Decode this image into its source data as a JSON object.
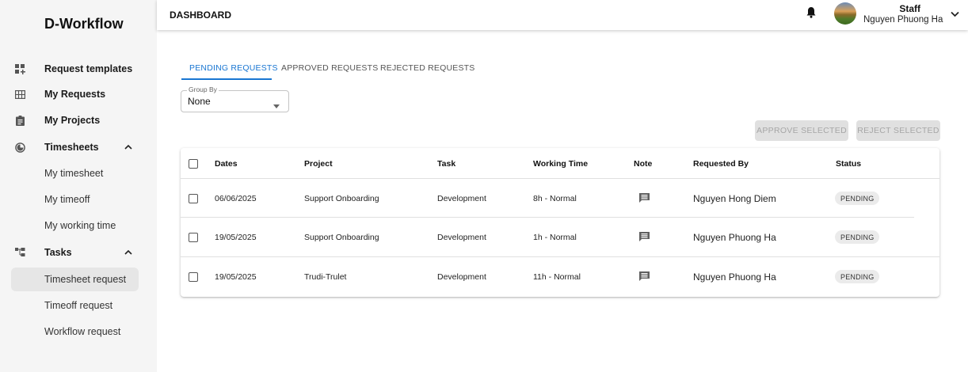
{
  "app": {
    "brand": "D-Workflow"
  },
  "header": {
    "title": "DASHBOARD",
    "user_role": "Staff",
    "user_name": "Nguyen Phuong Ha"
  },
  "sidebar": {
    "items": [
      {
        "label": "Request templates",
        "icon": "templates-icon"
      },
      {
        "label": "My Requests",
        "icon": "grid-icon"
      },
      {
        "label": "My Projects",
        "icon": "clipboard-icon"
      },
      {
        "label": "Timesheets",
        "icon": "timesheets-icon"
      },
      {
        "label": "Tasks",
        "icon": "tasks-icon"
      }
    ],
    "timesheet_children": [
      "My timesheet",
      "My timeoff",
      "My working time"
    ],
    "task_children": [
      "Timesheet request",
      "Timeoff request",
      "Workflow request"
    ]
  },
  "tabs": [
    "PENDING REQUESTS",
    "APPROVED REQUESTS",
    "REJECTED REQUESTS"
  ],
  "group_by": {
    "label": "Group By",
    "value": "None"
  },
  "buttons": {
    "approve": "APPROVE SELECTED",
    "reject": "REJECT SELECTED"
  },
  "table": {
    "headers": [
      "Dates",
      "Project",
      "Task",
      "Working Time",
      "Note",
      "Requested By",
      "Status"
    ],
    "rows": [
      {
        "date": "06/06/2025",
        "project": "Support Onboarding",
        "task": "Development",
        "working_time": "8h - Normal",
        "requested_by": "Nguyen Hong Diem",
        "status": "PENDING"
      },
      {
        "date": "19/05/2025",
        "project": "Support Onboarding",
        "task": "Development",
        "working_time": "1h - Normal",
        "requested_by": "Nguyen Phuong Ha",
        "status": "PENDING"
      },
      {
        "date": "19/05/2025",
        "project": "Trudi-Trulet",
        "task": "Development",
        "working_time": "11h - Normal",
        "requested_by": "Nguyen Phuong Ha",
        "status": "PENDING"
      }
    ]
  },
  "colors": {
    "accent": "#1976d2",
    "sidebar_bg": "#f5f5f5"
  }
}
